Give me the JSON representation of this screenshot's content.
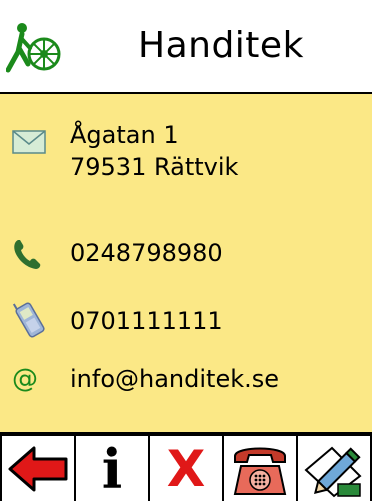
{
  "header": {
    "title": "Handitek",
    "logo": "handitek-wheelchair-logo"
  },
  "contact": {
    "address_line1": "Ågatan 1",
    "address_line2": "79531 Rättvik",
    "phone": "0248798980",
    "mobile": "0701111111",
    "email": "info@handitek.se"
  },
  "icons": {
    "address": "envelope-icon",
    "phone": "phone-handset-icon",
    "mobile": "mobile-phone-icon",
    "email": "at-sign-icon"
  },
  "email_symbol": "@",
  "toolbar": {
    "back": "back-arrow-icon",
    "info": "info-icon",
    "delete": "delete-x-icon",
    "call": "call-phone-icon",
    "edit": "edit-pencil-icon",
    "info_glyph": "i",
    "delete_glyph": "X"
  },
  "colors": {
    "background": "#fbe886",
    "accent_green": "#1b8a1b",
    "red": "#e01818"
  }
}
